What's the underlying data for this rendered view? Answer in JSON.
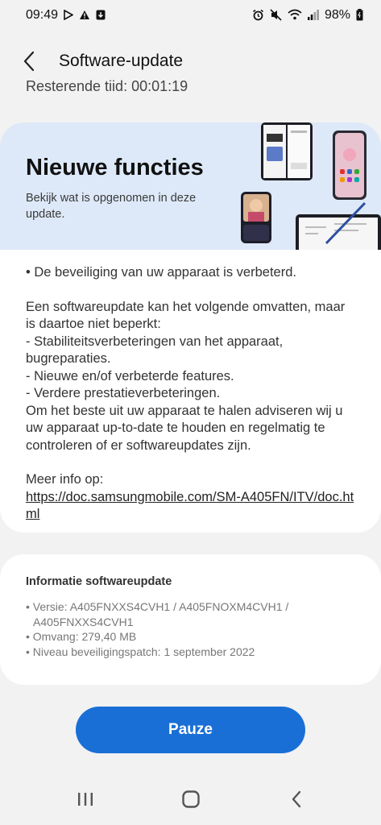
{
  "status_bar": {
    "time": "09:49",
    "battery": "98%",
    "left_icons": [
      "play-store-icon",
      "warning-icon",
      "download-icon"
    ],
    "right_icons": [
      "alarm-icon",
      "mute-icon",
      "wifi-icon",
      "signal-icon",
      "battery-icon"
    ]
  },
  "header": {
    "title": "Software-update",
    "remaining_time": "Resterende tijd: 00:01:19"
  },
  "hero": {
    "title": "Nieuwe functies",
    "subtitle": "Bekijk wat is opgenomen in deze update.",
    "background_color": "#dde9f8"
  },
  "release_notes": {
    "bullet": "• De beveiliging van uw apparaat is verbeterd.",
    "intro": "Een softwareupdate kan het volgende omvatten, maar is daartoe niet beperkt:",
    "items": [
      " - Stabiliteitsverbeteringen van het apparaat, bugreparaties.",
      " - Nieuwe en/of verbeterde features.",
      " - Verdere prestatieverbeteringen."
    ],
    "advice": "Om het beste uit uw apparaat te halen adviseren wij u uw apparaat up-to-date te houden en regelmatig te controleren of er softwareupdates zijn.",
    "more_info_label": "Meer info op:",
    "more_info_link": "https://doc.samsungmobile.com/SM-A405FN/ITV/doc.html"
  },
  "info": {
    "title": "Informatie softwareupdate",
    "lines": [
      "• Versie: A405FNXXS4CVH1 / A405FNOXM4CVH1 / A405FNXXS4CVH1",
      "• Omvang: 279,40 MB",
      "• Niveau beveiligingspatch: 1 september 2022"
    ]
  },
  "actions": {
    "pause_label": "Pauze",
    "accent_color": "#1a6fd6"
  },
  "nav": {
    "items": [
      "recent-apps-icon",
      "home-icon",
      "back-nav-icon"
    ]
  }
}
